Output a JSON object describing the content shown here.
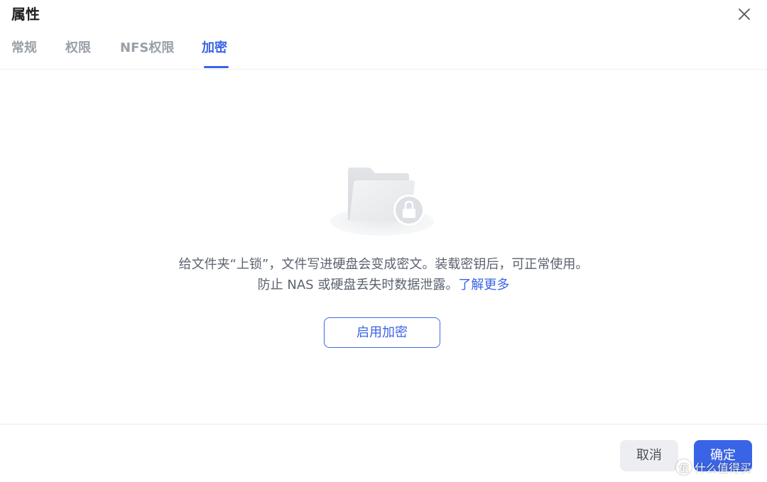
{
  "dialog": {
    "title": "属性",
    "close_icon": "close-icon"
  },
  "tabs": [
    {
      "label": "常规",
      "active": false
    },
    {
      "label": "权限",
      "active": false
    },
    {
      "label": "NFS权限",
      "active": false
    },
    {
      "label": "加密",
      "active": true
    }
  ],
  "encryption": {
    "illustration_icon": "locked-folder-icon",
    "description_line1": "给文件夹“上锁”，文件写进硬盘会变成密文。装载密钥后，可正常使用。",
    "description_line2": "防止 NAS 或硬盘丢失时数据泄露。",
    "learn_more": "了解更多",
    "enable_button": "启用加密"
  },
  "footer": {
    "cancel": "取消",
    "confirm": "确定"
  },
  "watermark": {
    "logo_char": "值",
    "text": "什么值得买"
  },
  "colors": {
    "accent": "#3a64e6",
    "tab_inactive": "#9aa0a8",
    "text_secondary": "#5c6370",
    "cancel_bg": "#eceef2"
  }
}
